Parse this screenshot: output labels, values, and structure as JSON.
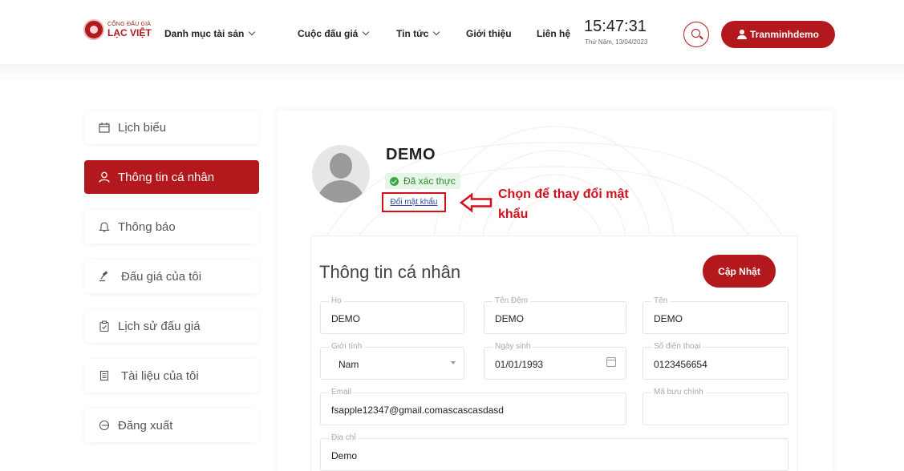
{
  "header": {
    "logo": {
      "line1": "CỔNG ĐẤU GIÁ",
      "line2": "LẠC VIỆT"
    },
    "nav": [
      {
        "label": "Danh mục tài sản",
        "dropdown": true
      },
      {
        "label": "Cuộc đấu giá",
        "dropdown": true
      },
      {
        "label": "Tin tức",
        "dropdown": true
      },
      {
        "label": "Giới thiệu",
        "dropdown": false
      },
      {
        "label": "Liên hệ",
        "dropdown": false
      }
    ],
    "clock": {
      "time": "15:47:31",
      "date": "Thứ Năm, 13/04/2023"
    },
    "search_icon": "search-icon",
    "user_button": "Tranminhdemo"
  },
  "sidebar": {
    "items": [
      {
        "label": "Lịch biểu",
        "icon": "calendar-icon",
        "active": false
      },
      {
        "label": "Thông tin cá nhân",
        "icon": "user-icon",
        "active": true
      },
      {
        "label": "Thông báo",
        "icon": "bell-icon",
        "active": false
      },
      {
        "label": "Đấu giá của tôi",
        "icon": "gavel-icon",
        "active": false
      },
      {
        "label": "Lịch sử đấu giá",
        "icon": "clipboard-icon",
        "active": false
      },
      {
        "label": "Tài liệu của tôi",
        "icon": "document-icon",
        "active": false
      },
      {
        "label": "Đăng xuất",
        "icon": "logout-icon",
        "active": false
      }
    ]
  },
  "profile": {
    "name": "DEMO",
    "verified_label": "Đã xác thực",
    "change_password": "Đổi mật khẩu",
    "annotation_line1": "Chọn để thay đổi mật",
    "annotation_line2": "khẩu"
  },
  "form": {
    "title": "Thông tin cá nhân",
    "update_button": "Cập Nhật",
    "fields": {
      "ho": {
        "label": "Họ",
        "value": "DEMO"
      },
      "ten_dem": {
        "label": "Tên Đệm",
        "value": "DEMO"
      },
      "ten": {
        "label": "Tên",
        "value": "DEMO"
      },
      "gioi_tinh": {
        "label": "Giới tính",
        "value": "Nam"
      },
      "ngay_sinh": {
        "label": "Ngày sinh",
        "value": "01/01/1993"
      },
      "so_dien_thoai": {
        "label": "Số điện thoại",
        "value": "0123456654"
      },
      "email": {
        "label": "Email",
        "value": "fsapple12347@gmail.comascascasdasd"
      },
      "ma_buu_chinh": {
        "label": "Mã bưu chính",
        "value": ""
      },
      "dia_chi": {
        "label": "Địa chỉ",
        "value": "Demo"
      }
    }
  },
  "colors": {
    "brand": "#b3191c",
    "verified": "#2e8a34",
    "annotation": "#d0101a",
    "link": "#2849a8"
  }
}
